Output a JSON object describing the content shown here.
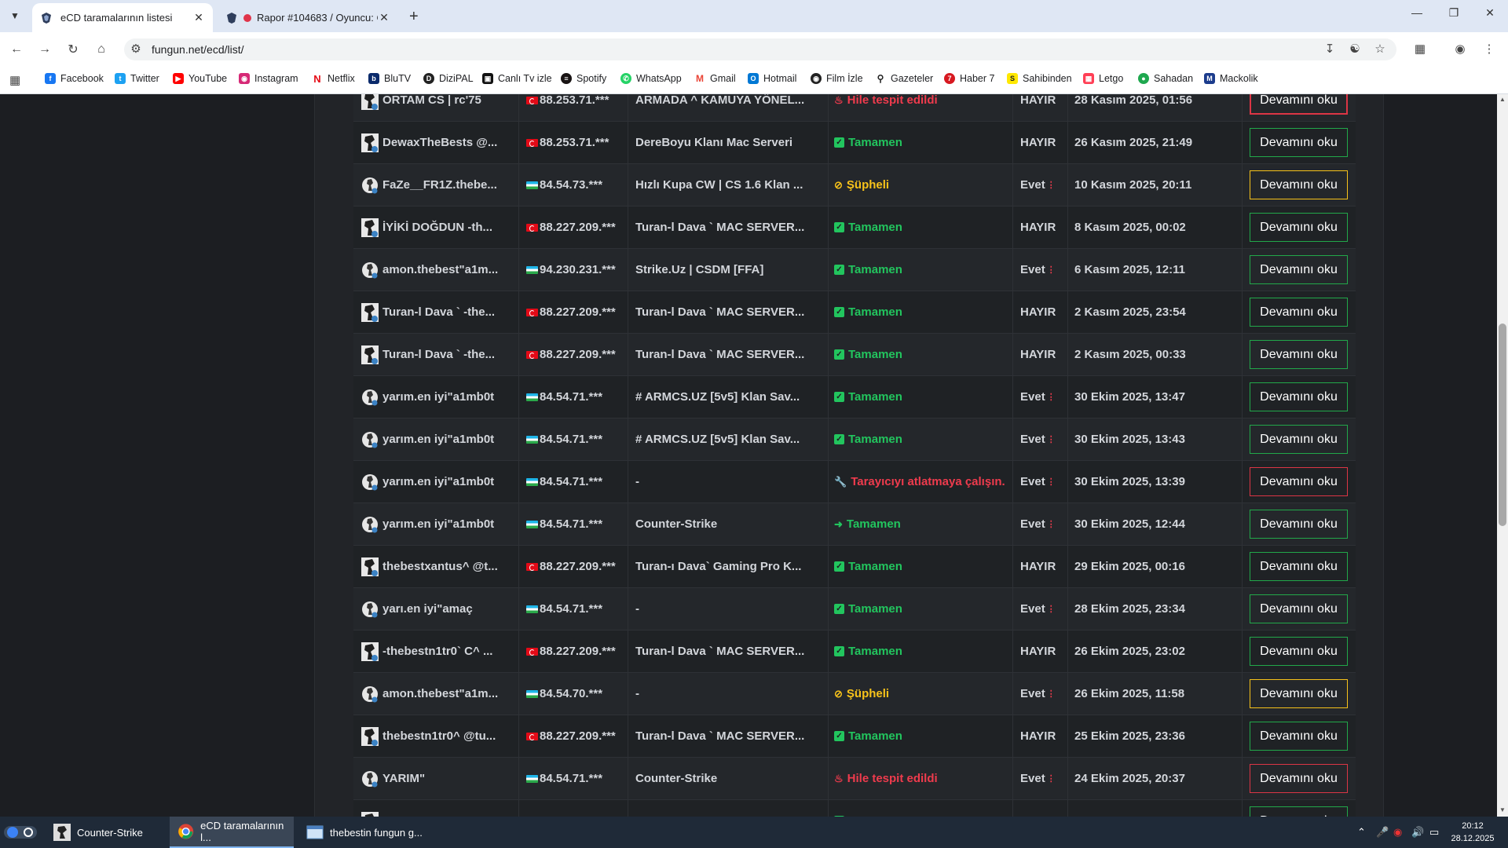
{
  "browser": {
    "tabs": [
      {
        "title": "eCD taramalarının listesi",
        "active": true
      },
      {
        "title": "Rapor #104683 / Oyuncu: C",
        "active": false
      }
    ],
    "url": "fungun.net/ecd/list/",
    "bookmarks": [
      "Facebook",
      "Twitter",
      "YouTube",
      "Instagram",
      "Netflix",
      "BluTV",
      "DiziPAL",
      "Canlı Tv izle",
      "Spotify",
      "WhatsApp",
      "Gmail",
      "Hotmail",
      "Film İzle",
      "Gazeteler",
      "Haber 7",
      "Sahibinden",
      "Letgo",
      "Sahadan",
      "Mackolik"
    ]
  },
  "table": {
    "button_label": "Devamını oku",
    "rows": [
      {
        "player": "ORTAM CS | rc'75",
        "flag": "tr",
        "ip": "88.253.71.***",
        "server": "ARMADA ^ KAMUYA YÖNEL...",
        "status": "Hile tespit edildi",
        "status_type": "red",
        "steam": "HAYIR",
        "date": "28 Kasım 2025, 01:56",
        "button_style": "red-thick"
      },
      {
        "player": "DewaxTheBests @...",
        "flag": "tr",
        "ip": "88.253.71.***",
        "server": "DereBoyu Klanı Mac Serveri",
        "status": "Tamamen",
        "status_type": "green",
        "steam": "HAYIR",
        "date": "26 Kasım 2025, 21:49",
        "button_style": "green"
      },
      {
        "player": "FaZe__FR1Z.thebe...",
        "flag": "uz",
        "ip": "84.54.73.***",
        "server": "Hızlı Kupa CW | CS 1.6 Klan ...",
        "status": "Şüpheli",
        "status_type": "yellow",
        "steam": "Evet",
        "date": "10 Kasım 2025, 20:11",
        "button_style": "yellow"
      },
      {
        "player": "İYİKİ DOĞDUN -th...",
        "flag": "tr",
        "ip": "88.227.209.***",
        "server": "Turan-l Dava ` MAC SERVER...",
        "status": "Tamamen",
        "status_type": "green",
        "steam": "HAYIR",
        "date": "8 Kasım 2025, 00:02",
        "button_style": "green"
      },
      {
        "player": "amon.thebest\"a1m...",
        "flag": "uz",
        "ip": "94.230.231.***",
        "server": "Strike.Uz | CSDM [FFA]",
        "status": "Tamamen",
        "status_type": "green",
        "steam": "Evet",
        "date": "6 Kasım 2025, 12:11",
        "button_style": "green"
      },
      {
        "player": "Turan-l Dava ` -the...",
        "flag": "tr",
        "ip": "88.227.209.***",
        "server": "Turan-l Dava ` MAC SERVER...",
        "status": "Tamamen",
        "status_type": "green",
        "steam": "HAYIR",
        "date": "2 Kasım 2025, 23:54",
        "button_style": "green"
      },
      {
        "player": "Turan-l Dava ` -the...",
        "flag": "tr",
        "ip": "88.227.209.***",
        "server": "Turan-l Dava ` MAC SERVER...",
        "status": "Tamamen",
        "status_type": "green",
        "steam": "HAYIR",
        "date": "2 Kasım 2025, 00:33",
        "button_style": "green"
      },
      {
        "player": "yarım.en iyi\"a1mb0t",
        "flag": "uz",
        "ip": "84.54.71.***",
        "server": "# ARMCS.UZ [5v5] Klan Sav...",
        "status": "Tamamen",
        "status_type": "green",
        "steam": "Evet",
        "date": "30 Ekim 2025, 13:47",
        "button_style": "green"
      },
      {
        "player": "yarım.en iyi\"a1mb0t",
        "flag": "uz",
        "ip": "84.54.71.***",
        "server": "# ARMCS.UZ [5v5] Klan Sav...",
        "status": "Tamamen",
        "status_type": "green",
        "steam": "Evet",
        "date": "30 Ekim 2025, 13:43",
        "button_style": "green"
      },
      {
        "player": "yarım.en iyi\"a1mb0t",
        "flag": "uz",
        "ip": "84.54.71.***",
        "server": "-",
        "status": "Tarayıcıyı atlatmaya çalışın.",
        "status_type": "red-wrench",
        "steam": "Evet",
        "date": "30 Ekim 2025, 13:39",
        "button_style": "red"
      },
      {
        "player": "yarım.en iyi\"a1mb0t",
        "flag": "uz",
        "ip": "84.54.71.***",
        "server": "Counter-Strike",
        "status": "Tamamen",
        "status_type": "green-exit",
        "steam": "Evet",
        "date": "30 Ekim 2025, 12:44",
        "button_style": "green"
      },
      {
        "player": "thebestxantus^ @t...",
        "flag": "tr",
        "ip": "88.227.209.***",
        "server": "Turan-ı Dava` Gaming Pro K...",
        "status": "Tamamen",
        "status_type": "green",
        "steam": "HAYIR",
        "date": "29 Ekim 2025, 00:16",
        "button_style": "green"
      },
      {
        "player": "yarı.en iyi\"amaç",
        "flag": "uz",
        "ip": "84.54.71.***",
        "server": "-",
        "status": "Tamamen",
        "status_type": "green",
        "steam": "Evet",
        "date": "28 Ekim 2025, 23:34",
        "button_style": "green"
      },
      {
        "player": "-thebestn1tr0` C^ ...",
        "flag": "tr",
        "ip": "88.227.209.***",
        "server": "Turan-l Dava ` MAC SERVER...",
        "status": "Tamamen",
        "status_type": "green",
        "steam": "HAYIR",
        "date": "26 Ekim 2025, 23:02",
        "button_style": "green"
      },
      {
        "player": "amon.thebest\"a1m...",
        "flag": "uz",
        "ip": "84.54.70.***",
        "server": "-",
        "status": "Şüpheli",
        "status_type": "yellow",
        "steam": "Evet",
        "date": "26 Ekim 2025, 11:58",
        "button_style": "yellow"
      },
      {
        "player": "thebestn1tr0^ @tu...",
        "flag": "tr",
        "ip": "88.227.209.***",
        "server": "Turan-l Dava ` MAC SERVER...",
        "status": "Tamamen",
        "status_type": "green",
        "steam": "HAYIR",
        "date": "25 Ekim 2025, 23:36",
        "button_style": "green"
      },
      {
        "player": "YARIM\"",
        "flag": "uz",
        "ip": "84.54.71.***",
        "server": "Counter-Strike",
        "status": "Hile tespit edildi",
        "status_type": "red",
        "steam": "Evet",
        "date": "24 Ekim 2025, 20:37",
        "button_style": "red"
      },
      {
        "player": "",
        "flag": "tr",
        "ip": "",
        "server": "",
        "status": "",
        "status_type": "green",
        "steam": "",
        "date": "",
        "button_style": "green"
      }
    ]
  },
  "taskbar": {
    "apps": [
      "Counter-Strike",
      "eCD taramalarının l...",
      "thebestin fungun g..."
    ],
    "time": "20:12",
    "date": "28.12.2025"
  },
  "colors": {
    "green": "#22c55e",
    "red": "#ef3b4d",
    "yellow": "#f7c21a",
    "bg": "#1c1e22"
  }
}
